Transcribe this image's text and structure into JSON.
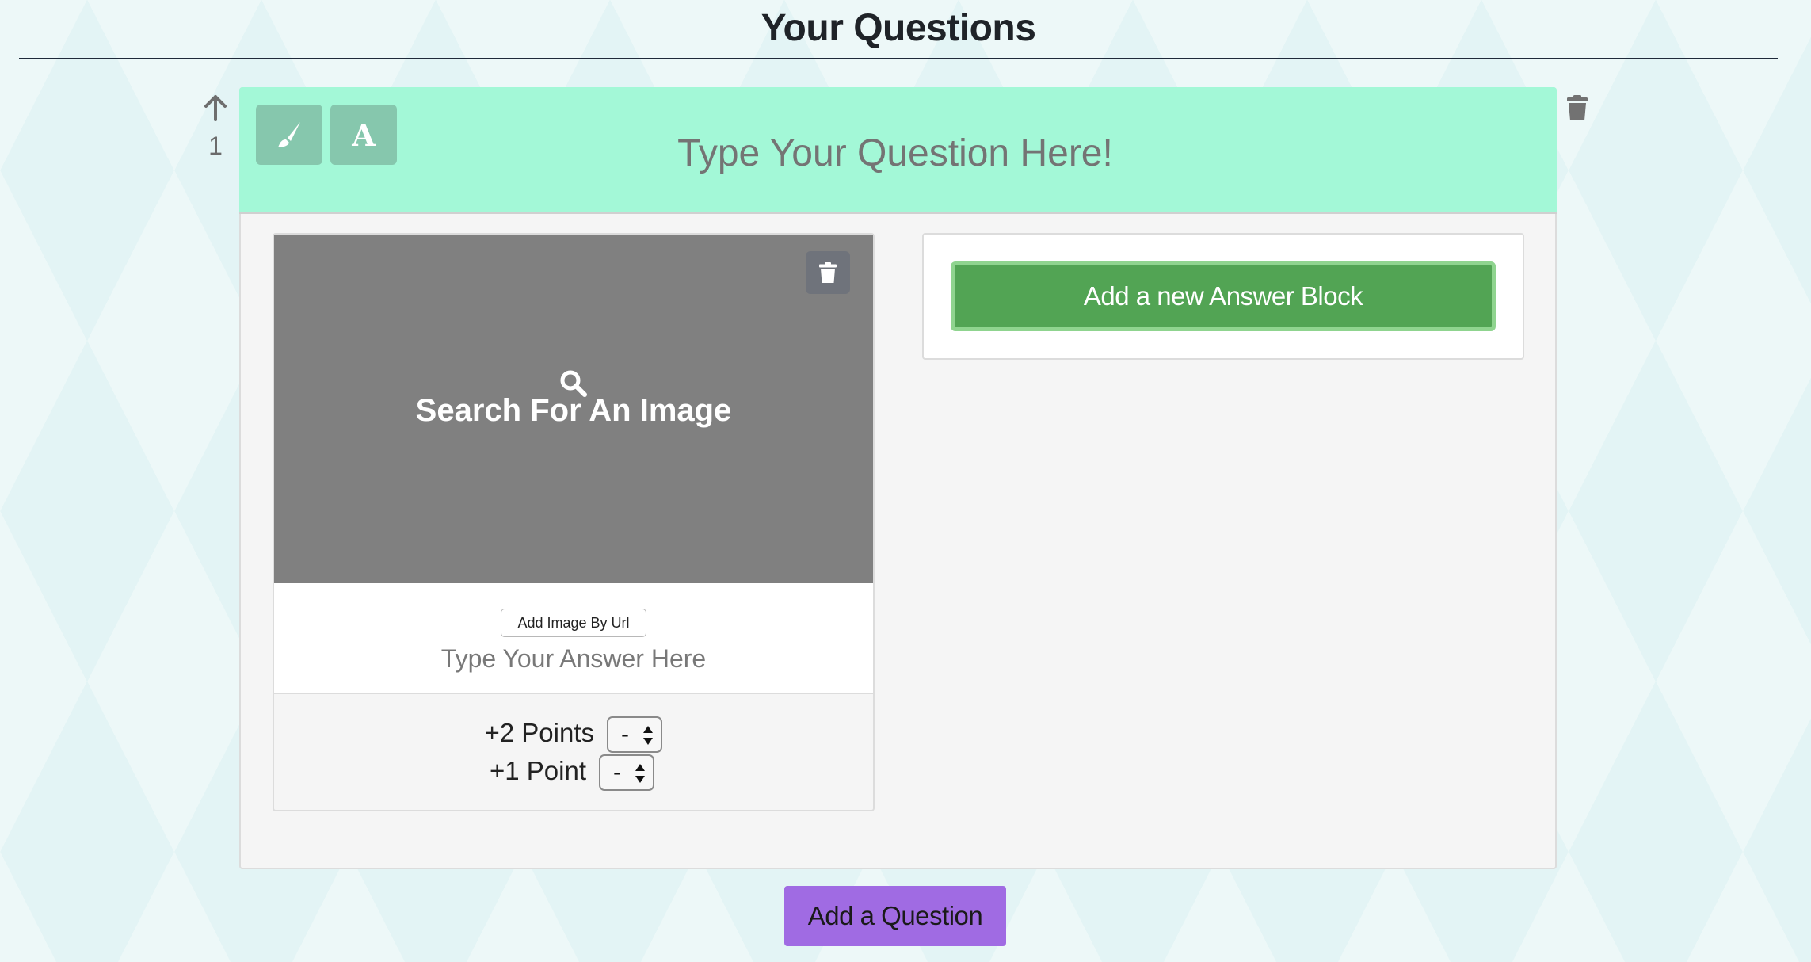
{
  "header": {
    "title": "Your Questions"
  },
  "question": {
    "number": "1",
    "placeholder": "Type Your Question Here!",
    "header_color": "#a3f8d7",
    "tools": {
      "style_icon": "paintbrush-icon",
      "font_label": "A"
    }
  },
  "answer": {
    "image_search_label": "Search For An Image",
    "add_image_url_label": "Add Image By Url",
    "placeholder": "Type Your Answer Here",
    "points_two_label": "+2 Points",
    "points_two_value": "-",
    "points_one_label": "+1 Point",
    "points_one_value": "-"
  },
  "actions": {
    "add_answer_block_label": "Add a new Answer Block",
    "add_question_label": "Add a Question"
  },
  "colors": {
    "answer_block_green": "#52a454",
    "add_question_purple": "#a06be3",
    "image_placeholder_gray": "#808080"
  }
}
